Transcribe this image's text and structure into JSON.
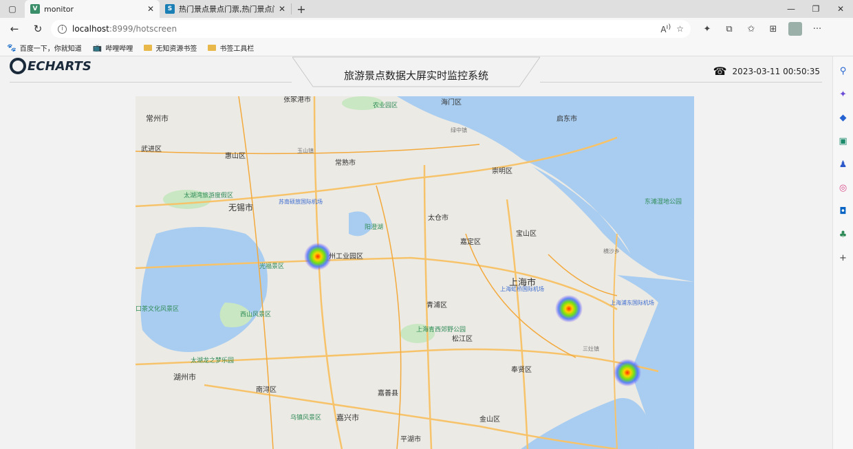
{
  "tabs": [
    {
      "title": "monitor",
      "favicon_color": "#3a8f6a",
      "favicon_glyph": "V",
      "active": true
    },
    {
      "title": "热门景点景点门票,热门景点门票",
      "favicon_color": "#1a7fb5",
      "favicon_glyph": "S",
      "active": false
    }
  ],
  "address": {
    "host": "localhost",
    "rest": ":8999/hotscreen"
  },
  "bookmarks": [
    {
      "label": "百度一下，你就知道",
      "icon": "paw-icon"
    },
    {
      "label": "哔哩哔哩",
      "icon": "bilibili-icon"
    },
    {
      "label": "无知资源书签",
      "icon": "folder-icon"
    },
    {
      "label": "书签工具栏",
      "icon": "folder-icon"
    }
  ],
  "page": {
    "logo_text": "ECHARTS",
    "title": "旅游景点数据大屏实时监控系统",
    "datetime": "2023-03-11 00:50:35"
  },
  "map_labels": {
    "changzhou": "常州市",
    "wujin": "武进区",
    "huishan": "惠山区",
    "wuxi": "无锡市",
    "zhangjiagang": "张家港市",
    "changshu": "常熟市",
    "haimen": "海门区",
    "qidong": "启东市",
    "chongming": "崇明区",
    "taicang": "太仓市",
    "baoshan": "宝山区",
    "jiading": "嘉定区",
    "shanghai": "上海市",
    "qingpu": "青浦区",
    "songjiang": "松江区",
    "fengxian": "奉贤区",
    "nanxun": "南浔区",
    "huzhou": "湖州市",
    "jiashan": "嘉善县",
    "jiaxing": "嘉兴市",
    "jinshan": "金山区",
    "pinghu": "平湖市",
    "suzhou_park": "州工业园区",
    "hongqiao": "上海虹桥国际机场",
    "pudong_airport": "上海浦东国际机场",
    "sunan_airport": "苏南硕放国际机场",
    "dongtan": "东滩湿地公园",
    "xishan": "西山风景区",
    "guangfu": "光福景区",
    "taihu": "太湖湾旅游度假区",
    "longzhimeng": "太湖龙之梦乐园",
    "wuzhen": "乌镇风景区",
    "qingxi": "上海青西郊野公园",
    "yangcheng": "阳澄湖",
    "heng_sha": "横沙乡",
    "sanzao": "三灶镇",
    "nongye": "农业园区",
    "luyuan": "绿中镇",
    "yushan": "玉山镇",
    "culture": "口茶文化风景区"
  },
  "colors": {
    "water": "#a9cdf0",
    "land": "#eceae4",
    "road": "#f7c36a",
    "green": "#c9e7c2"
  }
}
